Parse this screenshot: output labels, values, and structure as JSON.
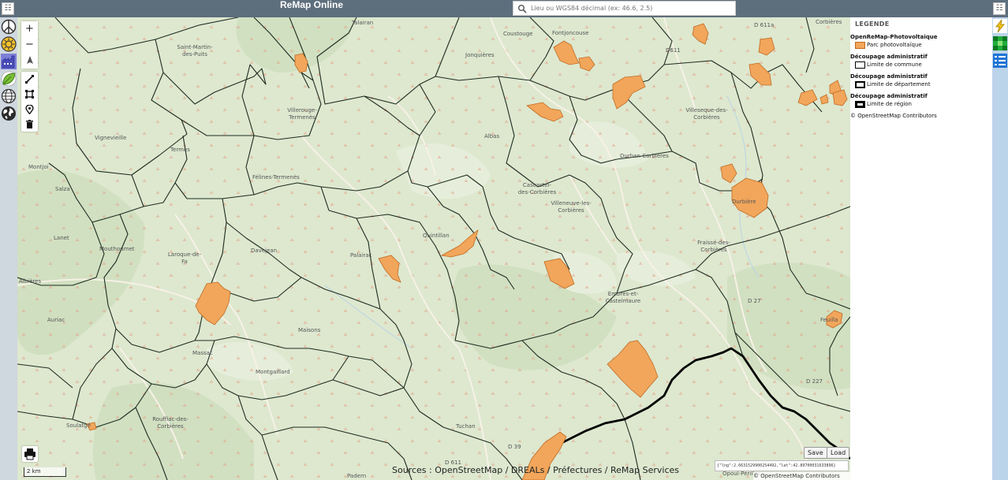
{
  "header": {
    "app_title": "ReMap Online",
    "search_placeholder": "Lieu ou WGS84 décimal (ex: 46.6, 2.5)",
    "menu_icon": "menu-icon"
  },
  "left_layers": [
    {
      "name": "peace-symbol-icon"
    },
    {
      "name": "sun-icon"
    },
    {
      "name": "industry-icon"
    },
    {
      "name": "leaf-icon"
    },
    {
      "name": "globe-grid-icon"
    },
    {
      "name": "earth-icon"
    }
  ],
  "right_layers": [
    {
      "name": "lightning-icon"
    },
    {
      "name": "green-grid-icon"
    },
    {
      "name": "list-icon"
    }
  ],
  "map_controls": {
    "zoom_in": "+",
    "zoom_out": "−"
  },
  "places": [
    {
      "name": "Talairan"
    },
    {
      "name": "Coustouge"
    },
    {
      "name": "Fontjoncouse"
    },
    {
      "name": "Saint-Martin-des-Puits"
    },
    {
      "name": "Jonquières"
    },
    {
      "name": "Villerouge-Termenès"
    },
    {
      "name": "Albas"
    },
    {
      "name": "Villeseque-des-Corbières"
    },
    {
      "name": "Vignevieille"
    },
    {
      "name": "Termes"
    },
    {
      "name": "Montjoi"
    },
    {
      "name": "Durban-Corbières"
    },
    {
      "name": "Félines-Termenès"
    },
    {
      "name": "Cascastel-des-Corbières"
    },
    {
      "name": "Villeneuve-les-Corbières"
    },
    {
      "name": "Salza"
    },
    {
      "name": "Lanet"
    },
    {
      "name": "Quintillan"
    },
    {
      "name": "Fraissé-des-Corbières"
    },
    {
      "name": "Mouthoumet"
    },
    {
      "name": "Laroque-de-Fa"
    },
    {
      "name": "Davejean"
    },
    {
      "name": "Palairac"
    },
    {
      "name": "Albières"
    },
    {
      "name": "Embres-et-Castelmaure"
    },
    {
      "name": "Auriac"
    },
    {
      "name": "Maisons"
    },
    {
      "name": "Massac"
    },
    {
      "name": "Feuilla"
    },
    {
      "name": "Montgaillard"
    },
    {
      "name": "Rouffiac-des-Corbières"
    },
    {
      "name": "Soulatgé"
    },
    {
      "name": "Tuchan"
    },
    {
      "name": "Padern"
    },
    {
      "name": "Corbières"
    },
    {
      "name": "Durbière"
    },
    {
      "name": "Opoul-Périllos"
    }
  ],
  "roads": {
    "d611a": "D 611a",
    "d611": "D611",
    "d27": "D 27",
    "d227": "D 227",
    "d39": "D 39",
    "d611b": "D 611"
  },
  "legend": {
    "title": "LEGENDE",
    "groups": [
      {
        "heading": "OpenReMap-Photovoltaique",
        "label": "Parc photovoltaïque",
        "color": "#f1a65b"
      },
      {
        "heading": "Découpage administratif",
        "label": "Limite de commune",
        "color": "#000000"
      },
      {
        "heading": "Découpage administratif",
        "label": "Limite de département",
        "color": "#000000"
      },
      {
        "heading": "Découpage administratif",
        "label": "Limite de région",
        "color": "#000000"
      }
    ],
    "osm_credit": "© OpenStreetMap Contributors"
  },
  "footer": {
    "scale": "2 km",
    "save": "Save",
    "load": "Load",
    "coords": "{\"lng\":2.6631529900254492,\"lat\":42.89700031633896}",
    "attribution": "© OpenStreetMap Contributors",
    "sources": "Sources : OpenStreetMap / DREALs / Préfectures / ReMap Services"
  },
  "colors": {
    "topbar": "#5d6e7c",
    "pv_fill": "#f1a65b",
    "pv_stroke": "#c26a22",
    "map_green": "#dde8cf"
  }
}
